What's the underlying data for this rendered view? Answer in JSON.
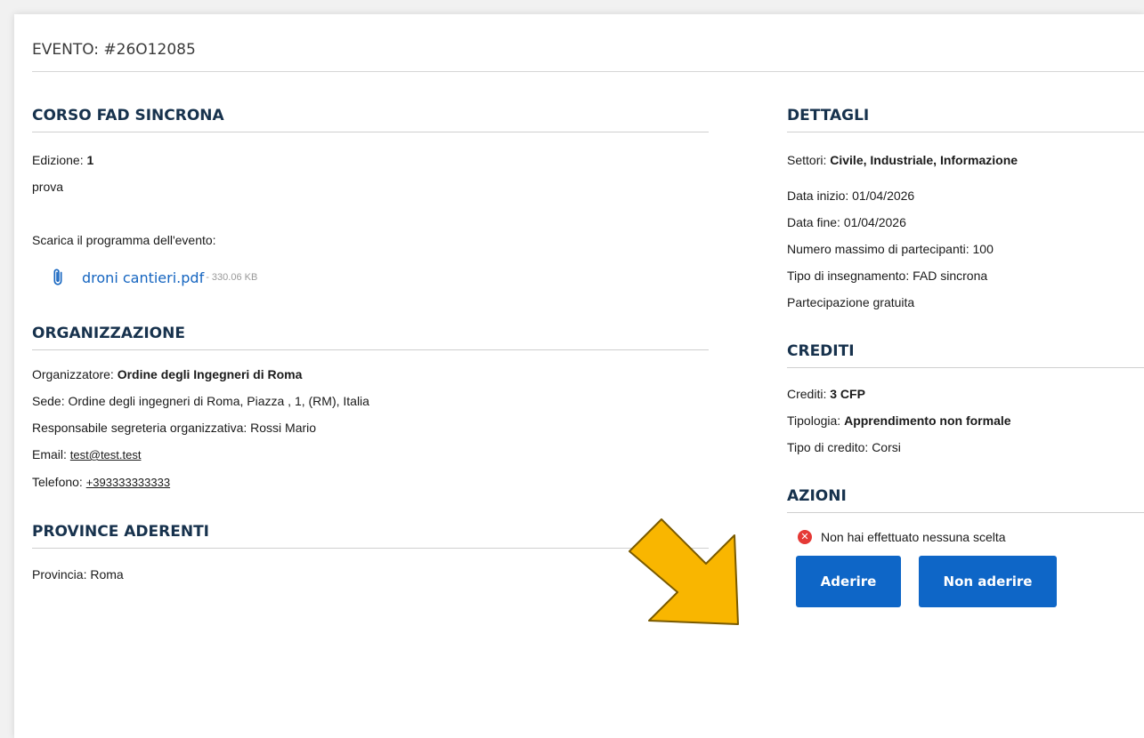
{
  "event": {
    "title": "EVENTO: #26O12085"
  },
  "course": {
    "heading": "CORSO FAD SINCRONA",
    "edition_label": "Edizione:",
    "edition_value": "1",
    "description": "prova",
    "download_label": "Scarica il programma dell'evento:",
    "file_name": "droni cantieri.pdf",
    "file_size": "- 330.06 KB"
  },
  "organization": {
    "heading": "ORGANIZZAZIONE",
    "organizer_label": "Organizzatore:",
    "organizer_value": "Ordine degli Ingegneri di Roma",
    "seat": "Sede: Ordine degli ingegneri di Roma, Piazza , 1, (RM), Italia",
    "secretary": "Responsabile segreteria organizzativa: Rossi Mario",
    "email_label": "Email:",
    "email_value": "test@test.test",
    "phone_label": "Telefono:",
    "phone_value": "+393333333333"
  },
  "provinces": {
    "heading": "PROVINCE ADERENTI",
    "province": "Provincia: Roma"
  },
  "details": {
    "heading": "DETTAGLI",
    "sectors_label": "Settori:",
    "sectors_value": "Civile, Industriale, Informazione",
    "start_date": "Data inizio: 01/04/2026",
    "end_date": "Data fine: 01/04/2026",
    "max_participants": "Numero massimo di partecipanti: 100",
    "teaching_type": "Tipo di insegnamento: FAD sincrona",
    "participation": "Partecipazione gratuita"
  },
  "credits": {
    "heading": "CREDITI",
    "credits_label": "Crediti:",
    "credits_value": "3 CFP",
    "type_label": "Tipologia:",
    "type_value": "Apprendimento non formale",
    "credit_kind": "Tipo di credito: Corsi"
  },
  "actions": {
    "heading": "AZIONI",
    "status": "Non hai effettuato nessuna scelta",
    "join_label": "Aderire",
    "decline_label": "Non aderire"
  },
  "colors": {
    "accent_blue": "#0e66c7",
    "heading_navy": "#17324d",
    "link_blue": "#1565c0",
    "error_red": "#e53935",
    "arrow_yellow": "#f9b600"
  },
  "icons": [
    "paperclip-icon",
    "error-x-icon",
    "pointer-arrow-icon"
  ]
}
